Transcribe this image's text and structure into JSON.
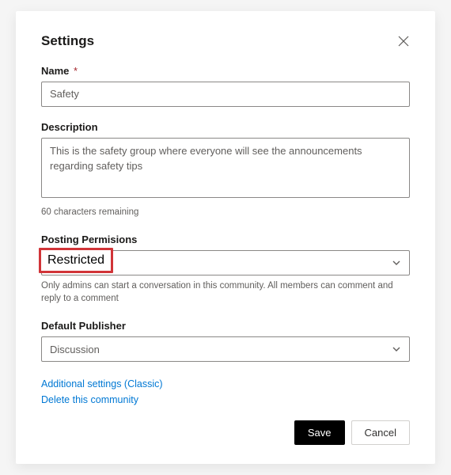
{
  "dialog": {
    "title": "Settings"
  },
  "name": {
    "label": "Name",
    "required_marker": "*",
    "value": "Safety"
  },
  "description": {
    "label": "Description",
    "value": "This is the safety group where everyone will see the announcements regarding safety tips",
    "remaining": "60 characters remaining"
  },
  "posting": {
    "label": "Posting Permisions",
    "selected": "Restricted",
    "helper": "Only admins can start a conversation in this community. All members can comment and reply to a comment"
  },
  "publisher": {
    "label": "Default Publisher",
    "selected": "Discussion"
  },
  "links": {
    "additional": "Additional settings (Classic)",
    "delete": "Delete this community"
  },
  "footer": {
    "save": "Save",
    "cancel": "Cancel"
  }
}
